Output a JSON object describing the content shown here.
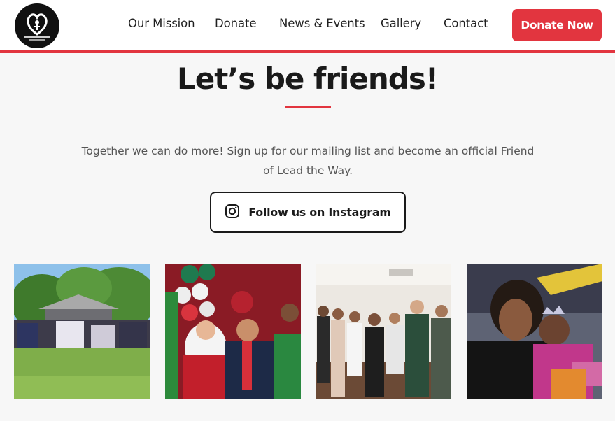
{
  "header": {
    "logo_icon": "lead-the-way-logo",
    "nav": [
      {
        "label": "Our Mission"
      },
      {
        "label": "Donate"
      },
      {
        "label": "News & Events"
      },
      {
        "label": "Gallery"
      },
      {
        "label": "Contact"
      }
    ],
    "cta_label": "Donate Now"
  },
  "colors": {
    "accent": "#e2353f",
    "background": "#f7f7f7",
    "text": "#1a1a1a"
  },
  "main": {
    "title": "Let’s be friends!",
    "subtitle": "Together we can do more! Sign up for our mailing list and become an official Friend of Lead the Way.",
    "instagram_button": {
      "icon": "instagram-icon",
      "label": "Follow us on Instagram"
    },
    "gallery": [
      {
        "name": "group-picnic-photo"
      },
      {
        "name": "santa-event-photo"
      },
      {
        "name": "team-group-photo"
      },
      {
        "name": "mother-daughter-photo"
      }
    ]
  }
}
